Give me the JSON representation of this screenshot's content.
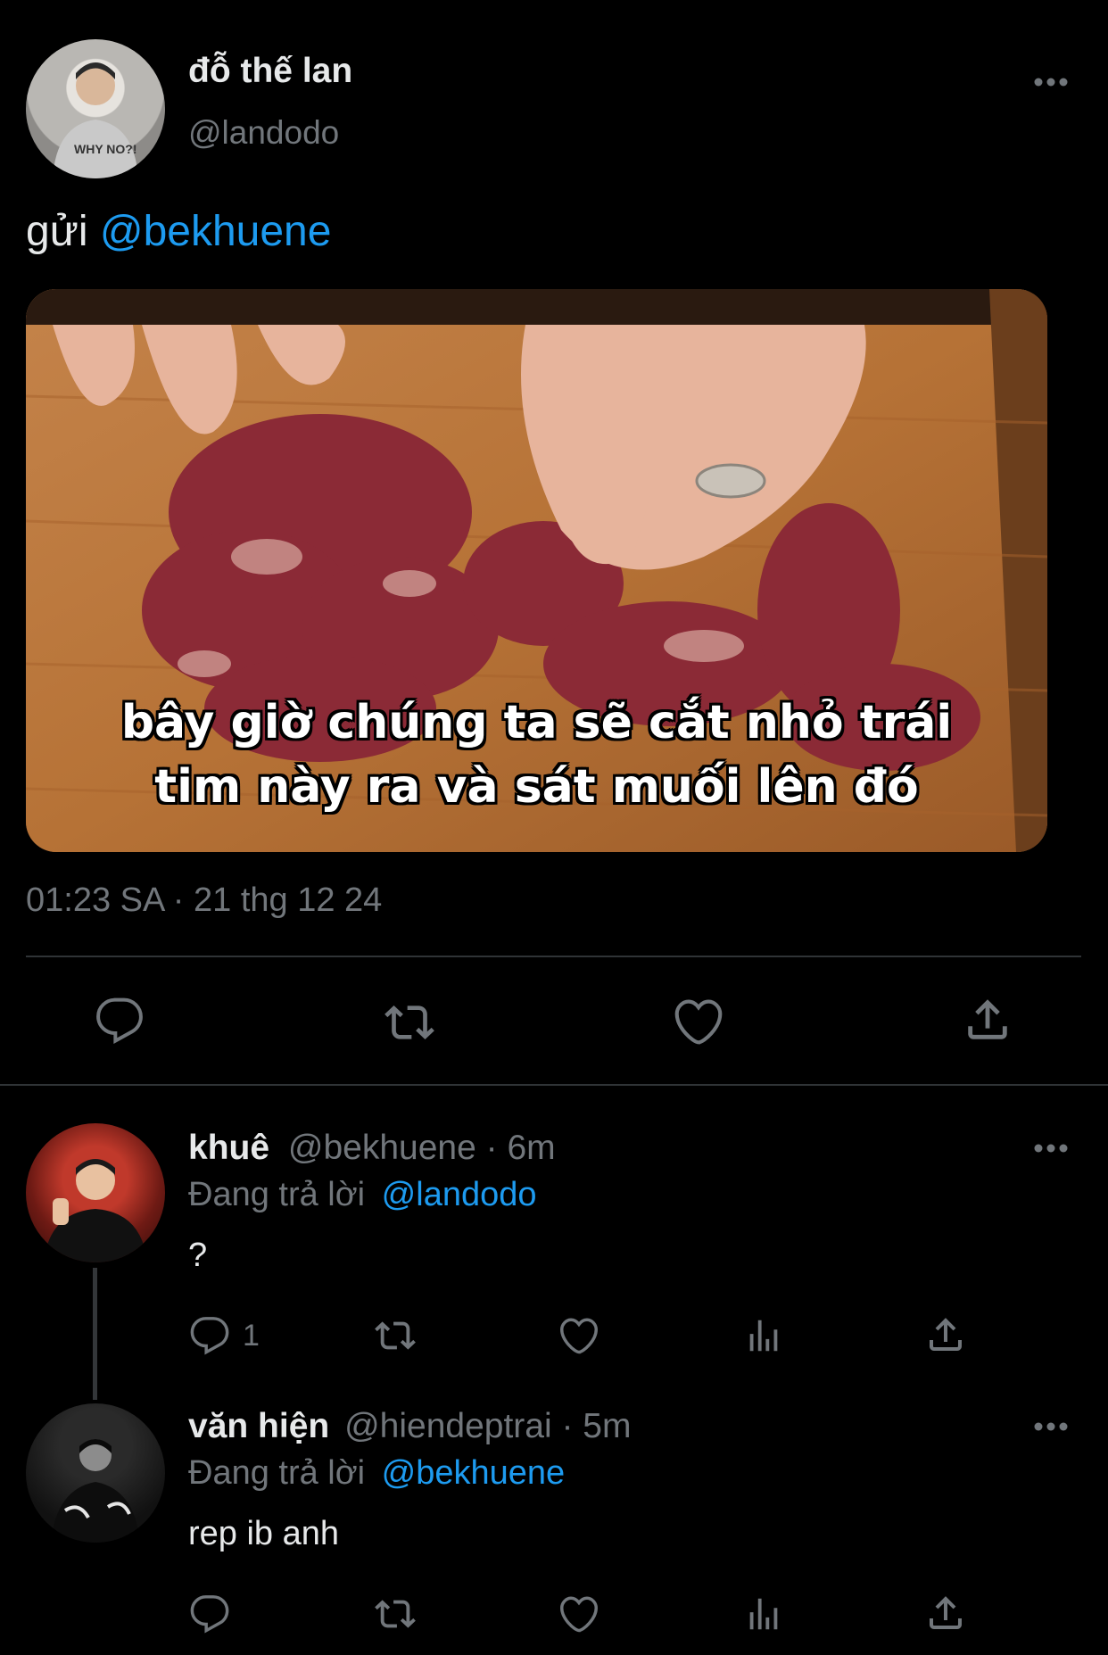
{
  "tweet": {
    "author_name": "đỗ thế lan",
    "author_handle": "@landodo",
    "text_prefix": "gửi",
    "text_mention": "@bekhuene",
    "image_caption_line1": "bây giờ chúng ta sẽ cắt nhỏ trái",
    "image_caption_line2": "tim này ra và sát muối lên đó",
    "timestamp": "01:23 SA · 21 thg 12 24"
  },
  "replies": [
    {
      "name": "khuê",
      "handle": "@bekhuene",
      "time": "· 6m",
      "replying_label": "Đang trả lời",
      "replying_to": "@landodo",
      "text": "?",
      "reply_count": "1"
    },
    {
      "name": "văn hiện",
      "handle": "@hiendeptrai",
      "time": "· 5m",
      "replying_label": "Đang trả lời",
      "replying_to": "@bekhuene",
      "text": "rep ib anh",
      "reply_count": ""
    }
  ],
  "icons": {
    "reply": "reply-icon",
    "retweet": "retweet-icon",
    "like": "heart-icon",
    "share": "share-icon",
    "views": "views-icon",
    "more": "more-icon"
  },
  "colors": {
    "background": "#000000",
    "text": "#e7e9ea",
    "muted": "#71767b",
    "link": "#1d9bf0",
    "divider": "#2f3336"
  }
}
